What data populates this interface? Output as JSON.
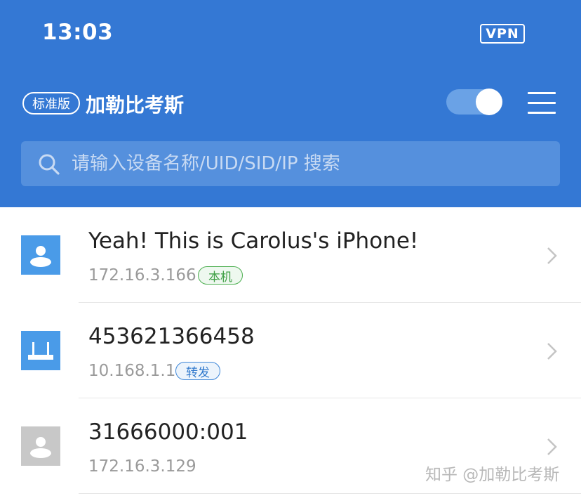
{
  "status_bar": {
    "time": "13:03",
    "vpn_label": "VPN"
  },
  "header": {
    "edition_badge": "标准版",
    "network_name": "加勒比考斯",
    "toggle_on": true
  },
  "search": {
    "placeholder": "请输入设备名称/UID/SID/IP 搜索"
  },
  "devices": [
    {
      "name": "Yeah! This is Carolus's iPhone!",
      "ip": "172.16.3.166",
      "tag": "本机",
      "icon": "person-icon",
      "icon_color": "#4a9be8"
    },
    {
      "name": "453621366458",
      "ip": "10.168.1.1",
      "tag": "转发",
      "icon": "router-icon",
      "icon_color": "#4a9be8"
    },
    {
      "name": "31666000:001",
      "ip": "172.16.3.129",
      "icon": "person-icon",
      "icon_color": "#c8c8c8"
    }
  ],
  "watermark": "知乎 @加勒比考斯",
  "colors": {
    "header_bg": "#3478d4",
    "local_tag": "#4caf50",
    "relay_tag": "#3d86d8"
  }
}
